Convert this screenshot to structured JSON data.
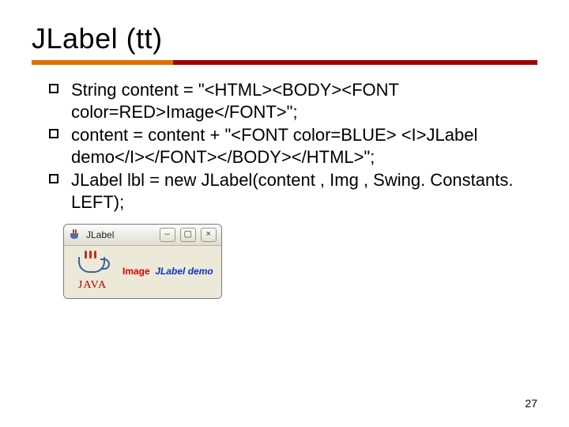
{
  "title": "JLabel (tt)",
  "bullets": [
    "String content = \"<HTML><BODY><FONT color=RED>Image</FONT>\";",
    "content = content + \"<FONT color=BLUE> <I>JLabel demo</I></FONT></BODY></HTML>\";",
    " JLabel lbl = new JLabel(content , Img , Swing. Constants. LEFT);"
  ],
  "window": {
    "title": "JLabel",
    "min_glyph": "–",
    "max_glyph": "▢",
    "close_glyph": "×",
    "java_word": "JAVA",
    "label_red": "Image",
    "label_blue": "JLabel demo"
  },
  "page_number": "27"
}
